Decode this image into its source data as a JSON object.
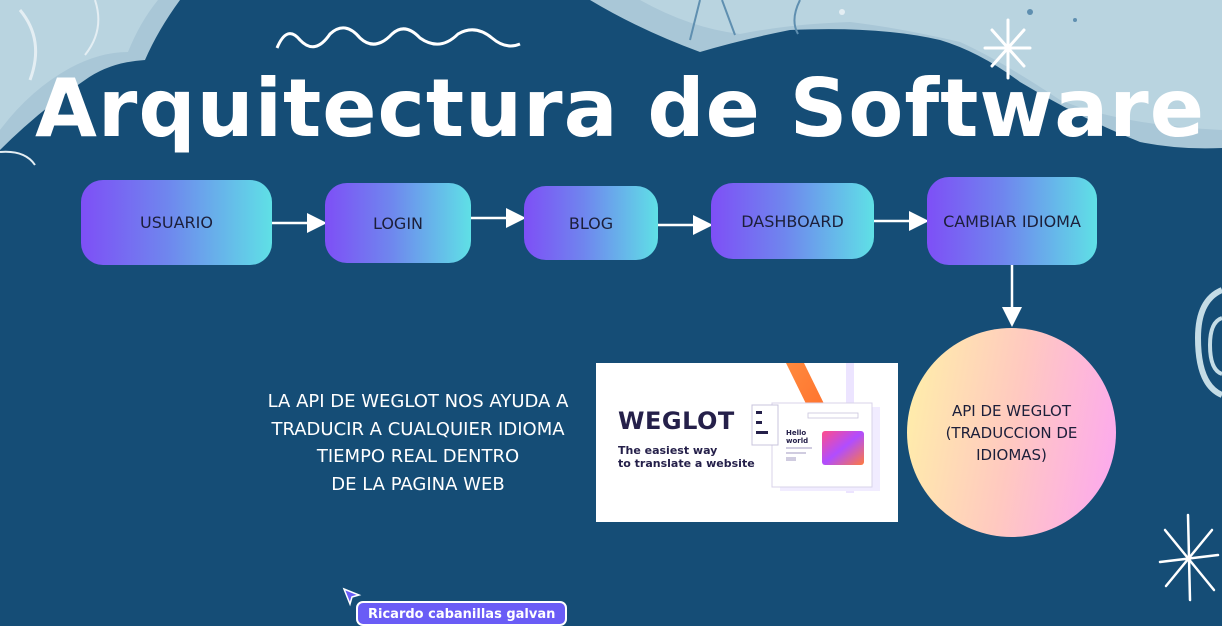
{
  "title": "Arquitectura de Software",
  "flow": {
    "nodes": [
      "USUARIO",
      "LOGIN",
      "BLOG",
      "DASHBOARD",
      "CAMBIAR IDIOMA"
    ]
  },
  "api_node": {
    "lines": [
      "API DE WEGLOT",
      "(TRADUCCION DE",
      "IDIOMAS)"
    ]
  },
  "description": {
    "lines": [
      "LA API DE WEGLOT NOS AYUDA A",
      "TRADUCIR A CUALQUIER IDIOMA",
      "TIEMPO REAL DENTRO",
      "DE LA PAGINA WEB"
    ]
  },
  "weglot_image": {
    "logo": "WEGLOT",
    "tagline": [
      "The easiest way",
      "to translate a website"
    ],
    "mock_text": [
      "Hello",
      "world"
    ]
  },
  "author_tag": "Ricardo cabanillas galvan",
  "colors": {
    "background": "#154d76",
    "node_gradient": [
      "#7e4ff6",
      "#5fe0e6"
    ],
    "circle_gradient": [
      "#fff1a8",
      "#fca6f2"
    ],
    "author_badge": "#6a5cf6"
  }
}
